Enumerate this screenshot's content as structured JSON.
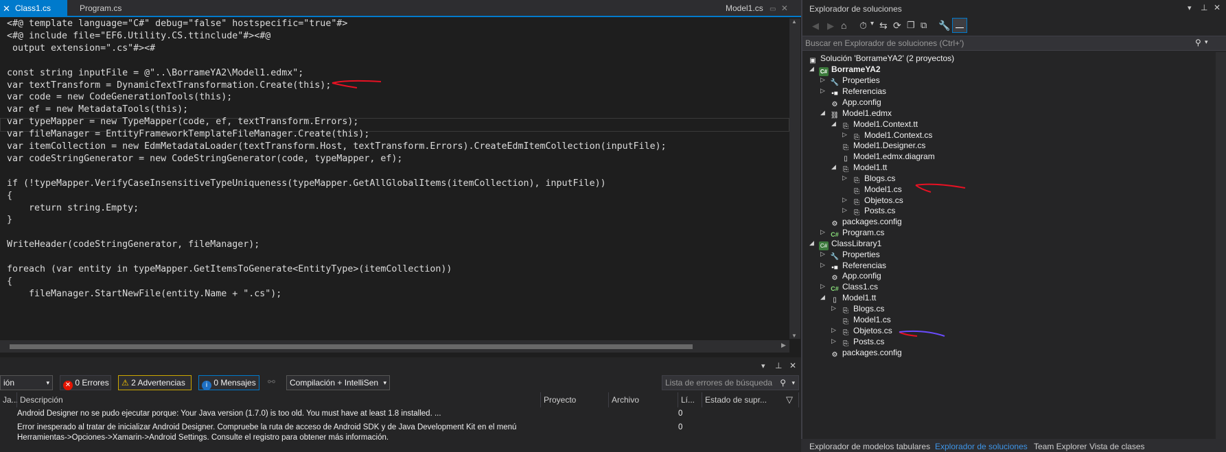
{
  "editor": {
    "tabs": [
      {
        "label": "Class1.cs",
        "close": "✕"
      },
      {
        "label": "Program.cs"
      }
    ],
    "right_tab": "Model1.cs",
    "lines": [
      "<#@ template language=\"C#\" debug=\"false\" hostspecific=\"true\"#>",
      "<#@ include file=\"EF6.Utility.CS.ttinclude\"#><#@",
      " output extension=\".cs\"#><#",
      "",
      "const string inputFile = @\"..\\BorrameYA2\\Model1.edmx\";",
      "var textTransform = DynamicTextTransformation.Create(this);",
      "var code = new CodeGenerationTools(this);",
      "var ef = new MetadataTools(this);",
      "var typeMapper = new TypeMapper(code, ef, textTransform.Errors);",
      "var fileManager = EntityFrameworkTemplateFileManager.Create(this);",
      "var itemCollection = new EdmMetadataLoader(textTransform.Host, textTransform.Errors).CreateEdmItemCollection(inputFile);",
      "var codeStringGenerator = new CodeStringGenerator(code, typeMapper, ef);",
      "",
      "if (!typeMapper.VerifyCaseInsensitiveTypeUniqueness(typeMapper.GetAllGlobalItems(itemCollection), inputFile))",
      "{",
      "    return string.Empty;",
      "}",
      "",
      "WriteHeader(codeStringGenerator, fileManager);",
      "",
      "foreach (var entity in typeMapper.GetItemsToGenerate<EntityType>(itemCollection))",
      "{",
      "    fileManager.StartNewFile(entity.Name + \".cs\");"
    ]
  },
  "error_list": {
    "scope_value": "ión",
    "errors_label": "0 Errores",
    "warnings_label": "2 Advertencias",
    "messages_label": "0 Mensajes",
    "build_filter": "Compilación + IntelliSen",
    "search_placeholder": "Lista de errores de búsqueda",
    "columns": {
      "code": "Ja...",
      "description": "Descripción",
      "project": "Proyecto",
      "file": "Archivo",
      "line": "Lí...",
      "state": "Estado de supr..."
    },
    "rows": [
      {
        "description": "Android Designer no se pudo ejecutar porque: Your Java version (1.7.0) is too old. You must have at least 1.8 installed. ...",
        "line": "0"
      },
      {
        "description": "Error inesperado al tratar de inicializar Android Designer. Compruebe la ruta de acceso de Android SDK y de Java Development Kit en el menú",
        "description2": "Herramientas->Opciones->Xamarin->Android Settings. Consulte el registro para obtener más información.",
        "line": "0"
      }
    ]
  },
  "solution_explorer": {
    "title": "Explorador de soluciones",
    "search_placeholder": "Buscar en Explorador de soluciones (Ctrl+')",
    "tree": [
      {
        "label": "Solución 'BorrameYA2'  (2 proyectos)",
        "icon": "solution-icon"
      },
      {
        "label": "BorrameYA2",
        "icon": "csharp-project-icon",
        "bold": true
      },
      {
        "label": "Properties",
        "icon": "wrench-icon"
      },
      {
        "label": "Referencias",
        "icon": "references-icon"
      },
      {
        "label": "App.config",
        "icon": "config-file-icon"
      },
      {
        "label": "Model1.edmx",
        "icon": "edmx-icon"
      },
      {
        "label": "Model1.Context.tt",
        "icon": "tt-file-icon"
      },
      {
        "label": "Model1.Context.cs",
        "icon": "cs-file-icon"
      },
      {
        "label": "Model1.Designer.cs",
        "icon": "cs-file-icon"
      },
      {
        "label": "Model1.edmx.diagram",
        "icon": "file-icon"
      },
      {
        "label": "Model1.tt",
        "icon": "tt-file-icon"
      },
      {
        "label": "Blogs.cs",
        "icon": "cs-file-icon"
      },
      {
        "label": "Model1.cs",
        "icon": "cs-file-icon"
      },
      {
        "label": "Objetos.cs",
        "icon": "cs-file-icon"
      },
      {
        "label": "Posts.cs",
        "icon": "cs-file-icon"
      },
      {
        "label": "packages.config",
        "icon": "config-file-icon"
      },
      {
        "label": "Program.cs",
        "icon": "csharp-file-icon"
      },
      {
        "label": "ClassLibrary1",
        "icon": "csharp-project-icon"
      },
      {
        "label": "Properties",
        "icon": "wrench-icon"
      },
      {
        "label": "Referencias",
        "icon": "references-icon"
      },
      {
        "label": "App.config",
        "icon": "config-file-icon"
      },
      {
        "label": "Class1.cs",
        "icon": "csharp-file-icon"
      },
      {
        "label": "Model1.tt",
        "icon": "file-icon"
      },
      {
        "label": "Blogs.cs",
        "icon": "cs-file-icon"
      },
      {
        "label": "Model1.cs",
        "icon": "cs-file-icon"
      },
      {
        "label": "Objetos.cs",
        "icon": "cs-file-icon"
      },
      {
        "label": "Posts.cs",
        "icon": "cs-file-icon"
      },
      {
        "label": "packages.config",
        "icon": "config-file-icon"
      }
    ],
    "bottom_tabs": [
      "Explorador de modelos tabulares",
      "Explorador de soluciones",
      "Team Explorer",
      "Vista de clases"
    ]
  },
  "colors": {
    "accent": "#007acc",
    "annotation": "#e81123",
    "annotation_blue": "#6a4cff"
  }
}
